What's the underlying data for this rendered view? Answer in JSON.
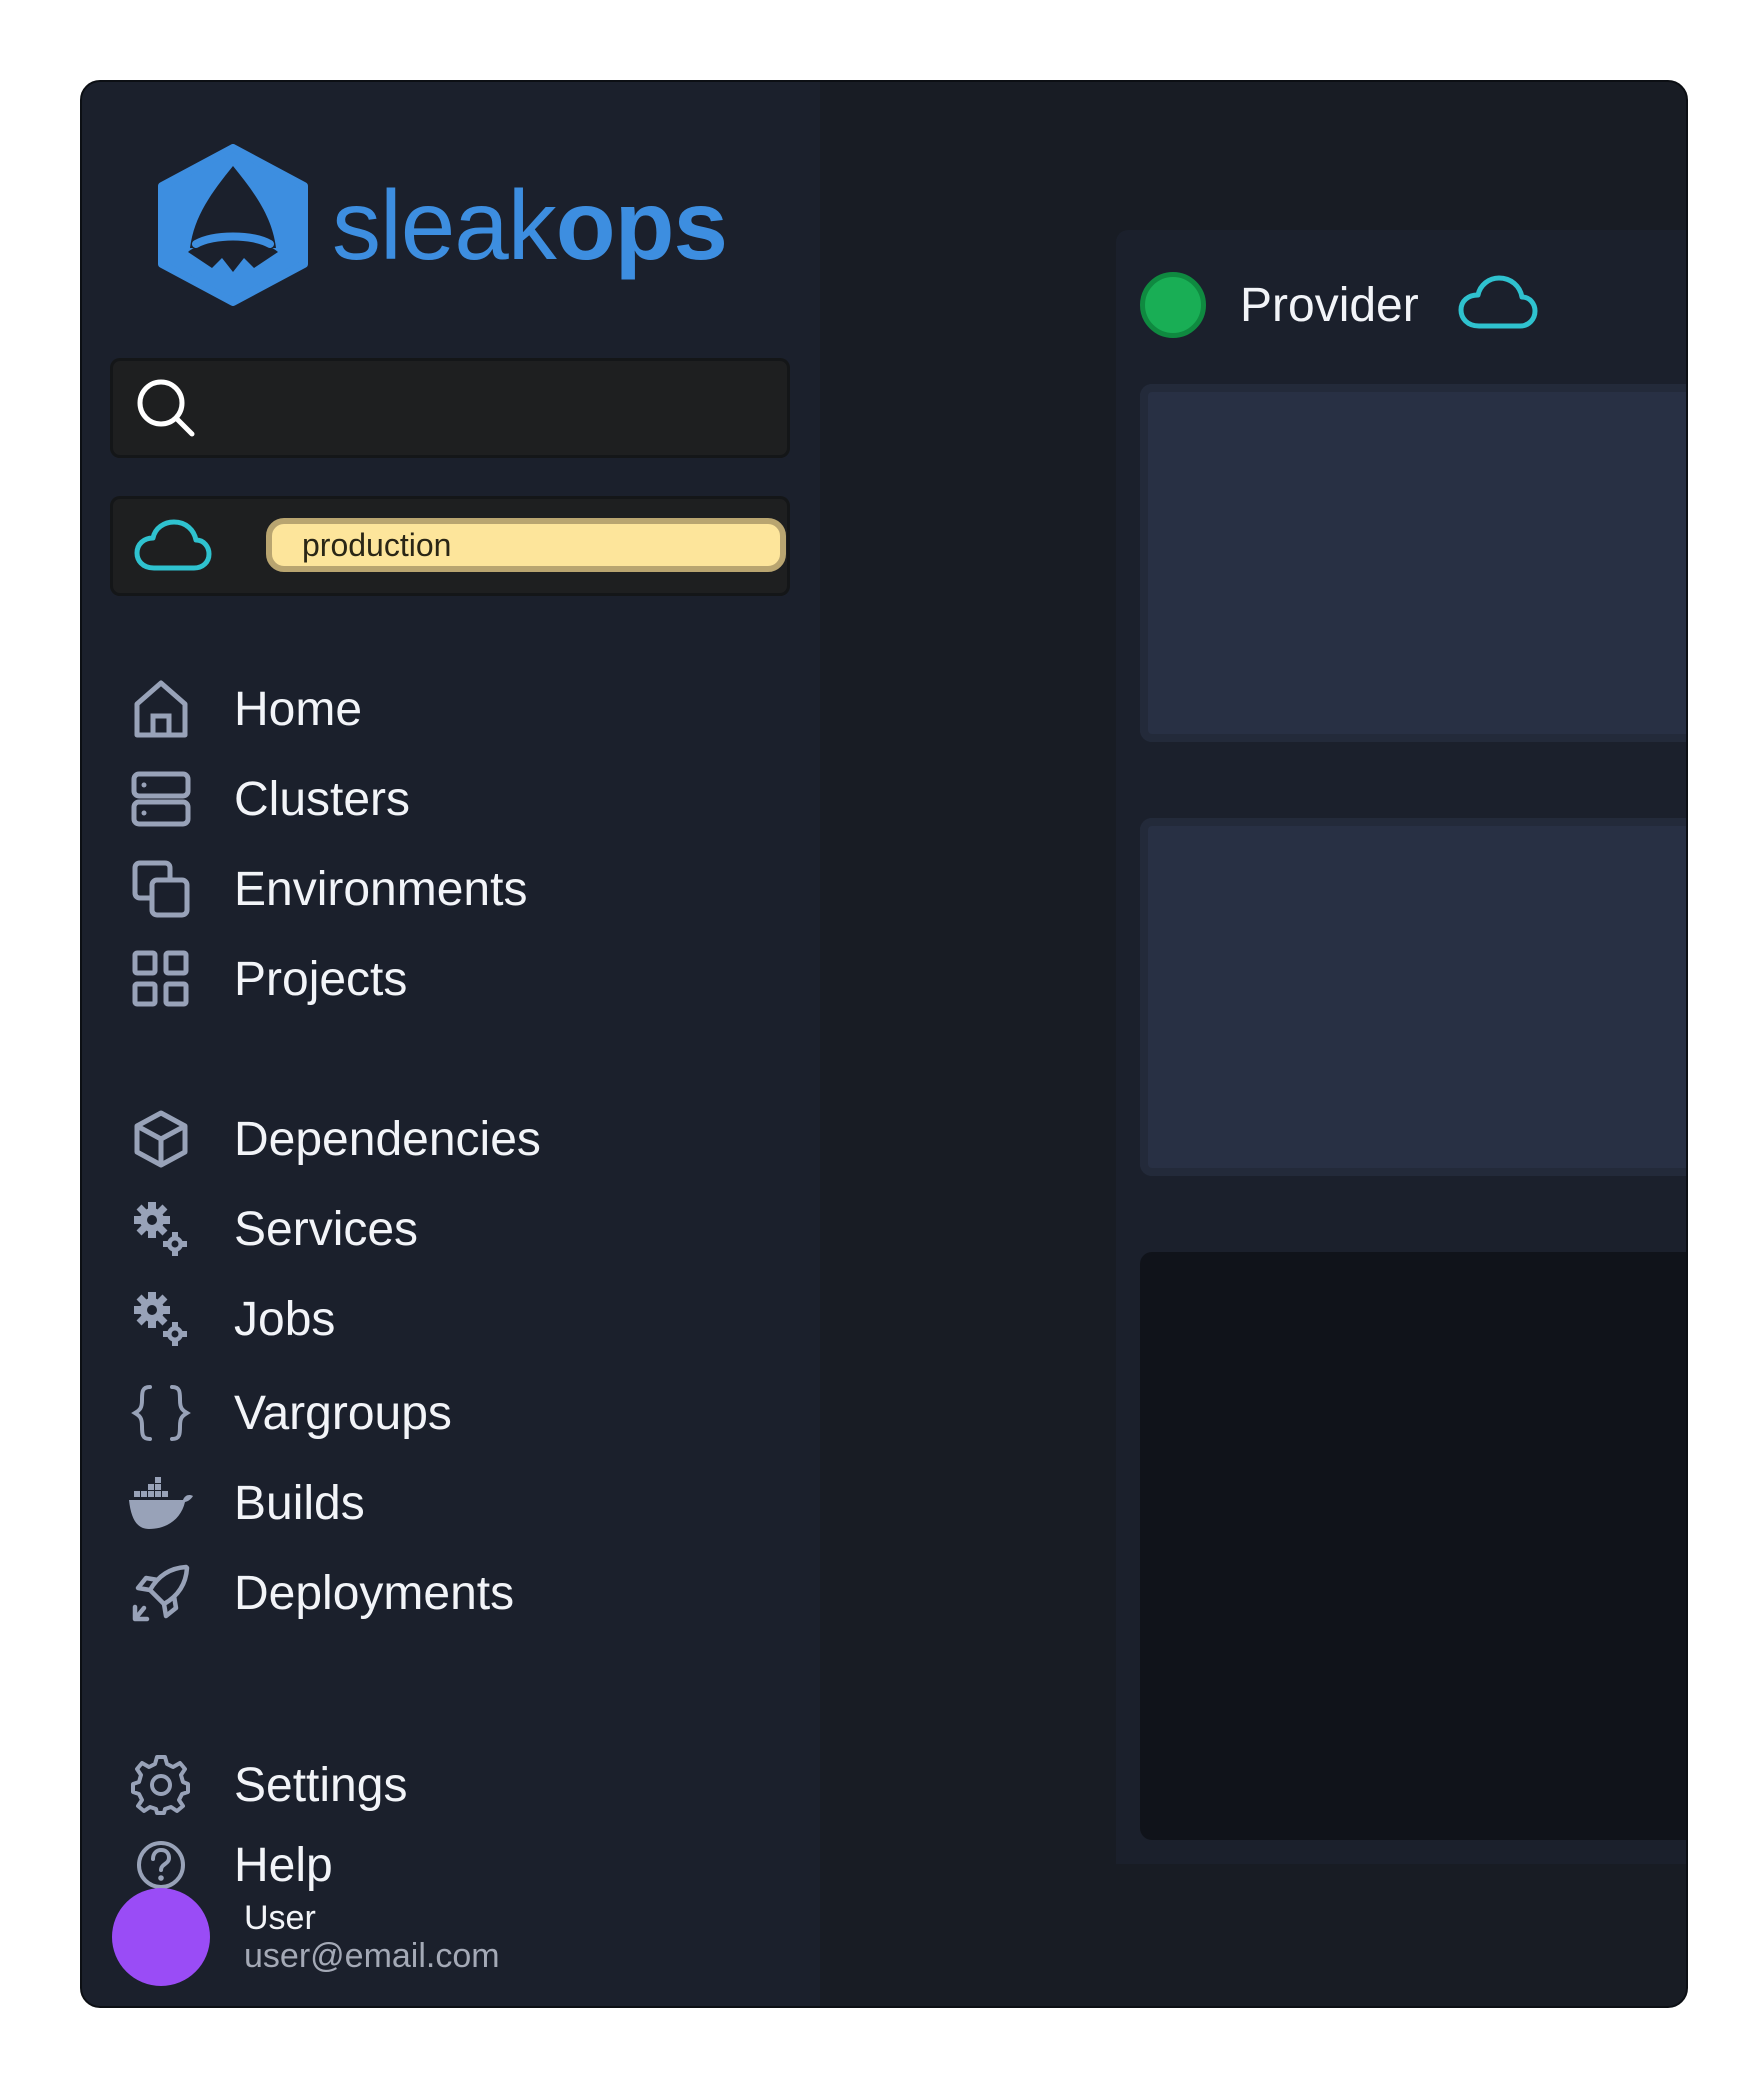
{
  "logo": {
    "text_light": "sleak",
    "text_bold": "ops"
  },
  "search": {
    "value": "",
    "placeholder": ""
  },
  "environment": {
    "badge": "production"
  },
  "nav": {
    "primary": [
      {
        "label": "Home",
        "icon": "home-icon"
      },
      {
        "label": "Clusters",
        "icon": "server-icon"
      },
      {
        "label": "Environments",
        "icon": "copy-icon"
      },
      {
        "label": "Projects",
        "icon": "grid-icon"
      }
    ],
    "secondary": [
      {
        "label": "Dependencies",
        "icon": "cube-icon"
      },
      {
        "label": "Services",
        "icon": "cogs-icon"
      },
      {
        "label": "Jobs",
        "icon": "cogs-icon"
      },
      {
        "label": "Vargroups",
        "icon": "braces-icon"
      },
      {
        "label": "Builds",
        "icon": "docker-icon"
      },
      {
        "label": "Deployments",
        "icon": "rocket-icon"
      }
    ],
    "footer": [
      {
        "label": "Settings",
        "icon": "gear-icon"
      },
      {
        "label": "Help",
        "icon": "help-icon"
      }
    ]
  },
  "user": {
    "name": "User",
    "email": "user@email.com"
  },
  "provider": {
    "label": "Provider"
  },
  "colors": {
    "brand": "#3d8ee0",
    "cloud": "#2fc2cf",
    "status_ok": "#19ae55",
    "avatar": "#9a4cf6",
    "badge": "#fde59b"
  }
}
